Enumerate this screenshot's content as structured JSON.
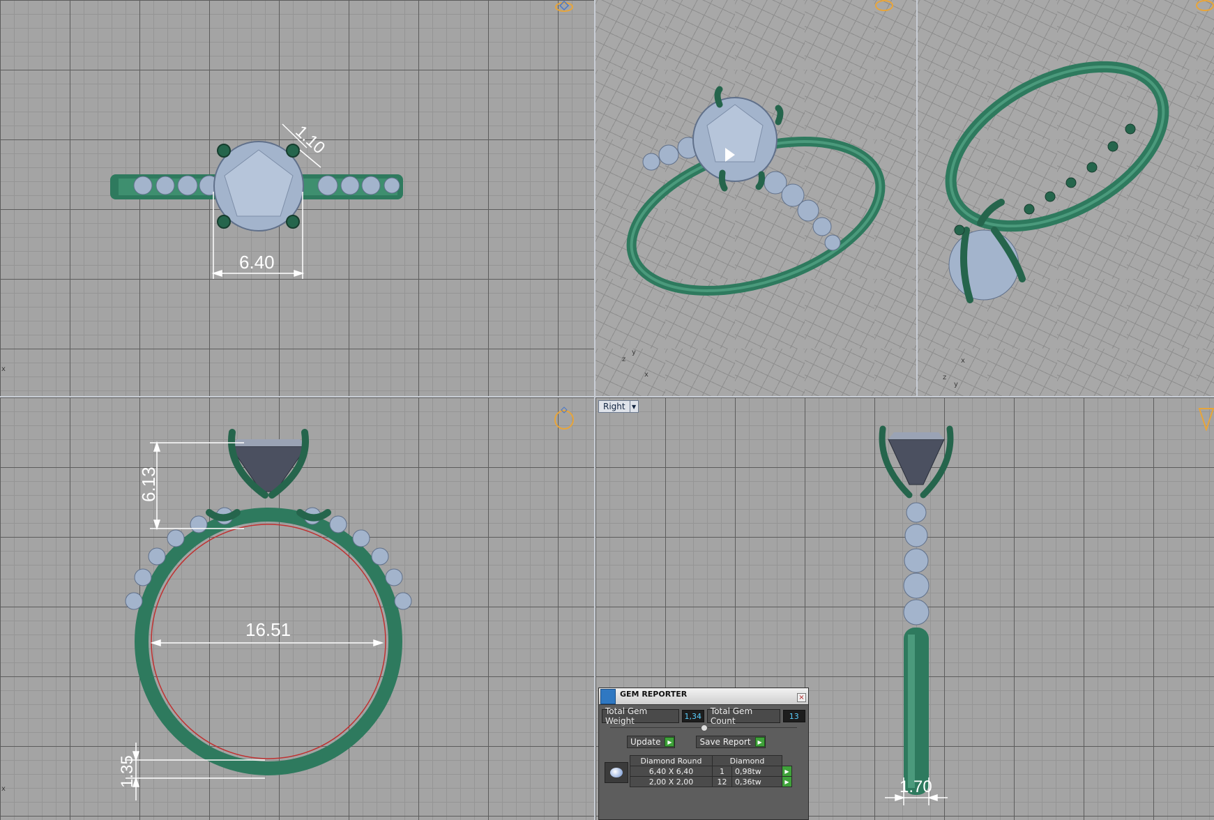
{
  "viewports": {
    "top": {
      "dimensions": {
        "width_label": "6.40",
        "prong_label": "1.10"
      }
    },
    "front": {
      "dimensions": {
        "height_label": "6.13",
        "inner_diameter_label": "16.51",
        "shank_label": "1.35"
      }
    },
    "right": {
      "view_menu_label": "Right",
      "dimensions": {
        "shank_width_label": "1.70"
      }
    },
    "perspective_left": {
      "axis_labels": [
        "z",
        "y",
        "x"
      ]
    },
    "perspective_right": {
      "axis_labels": [
        "x",
        "z",
        "y"
      ]
    }
  },
  "gem_reporter": {
    "title": "GEM REPORTER",
    "close_glyph": "×",
    "total_weight_label": "Total Gem Weight",
    "total_weight_value": "1,34",
    "total_count_label": "Total Gem Count",
    "total_count_value": "13",
    "update_label": "Update",
    "save_report_label": "Save Report",
    "table": {
      "headers": [
        "Diamond Round",
        "Diamond"
      ],
      "rows": [
        {
          "size": "6,40 X 6,40",
          "count": "1",
          "weight": "0,98tw"
        },
        {
          "size": "2,00 X 2,00",
          "count": "12",
          "weight": "0,36tw"
        }
      ]
    }
  },
  "colors": {
    "metal": "#2e7a5e",
    "gem": "#a3b4cc",
    "accent_gnomon": "#e8a53a",
    "dimension": "#ffffff"
  },
  "icons": [
    "ring-gnomon-icon",
    "gem-reporter-logo-icon",
    "close-icon",
    "play-arrow-icon",
    "dropdown-arrow-icon"
  ]
}
